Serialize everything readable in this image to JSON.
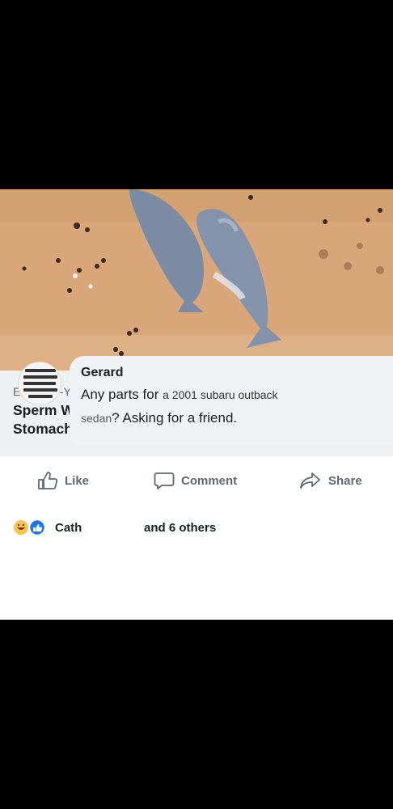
{
  "post": {
    "link_domain": "EXPAND-YOUR-CONSCIOUSNESS.COM",
    "headline_line1": "Sperm Whales Found Dead In Germany,",
    "headline_line2": "Stomachs FULL Of Plastic And Car Parts"
  },
  "actions": {
    "like_label": "Like",
    "comment_label": "Comment",
    "share_label": "Share"
  },
  "reactions": {
    "first_name": "Cath",
    "others_text": "and 6 others"
  },
  "comment": {
    "author": "Gerard",
    "line1_start": "Any parts for",
    "line1_insert": "a 2001 subaru outback",
    "line2_insert": "sedan",
    "line2_end": "? Asking for a friend."
  },
  "colors": {
    "sand": "#d9a97b",
    "whale": "#7e8fa8",
    "link_bg": "#eef0f2",
    "like_blue": "#1877f2"
  },
  "icons": [
    "thumbs-up-icon",
    "comment-bubble-icon",
    "share-arrow-icon",
    "like-reaction-icon",
    "haha-reaction-icon"
  ]
}
